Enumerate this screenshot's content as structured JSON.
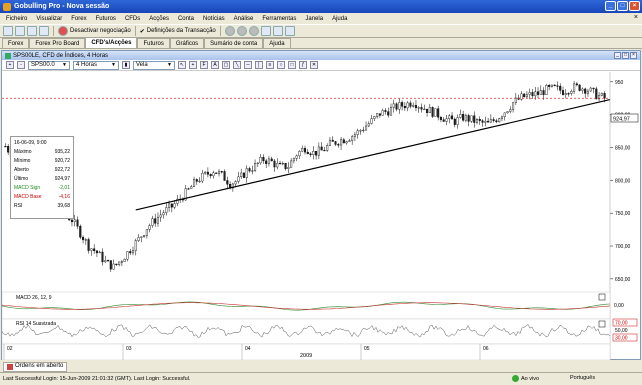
{
  "window": {
    "title": "Gobulling Pro - Nova sessão"
  },
  "menu": [
    "Ficheiro",
    "Visualizar",
    "Forex",
    "Futuros",
    "CFDs",
    "Acções",
    "Conta",
    "Notícias",
    "Análise",
    "Ferramentas",
    "Janela",
    "Ajuda"
  ],
  "toolbar": {
    "deactivate": "Desactivar negociação",
    "settings": "Definições da Transacção"
  },
  "tabs": [
    "Forex",
    "Forex Pro Board",
    "CFD's/Acções",
    "Futuros",
    "Gráficos",
    "Sumário de conta",
    "Ajuda"
  ],
  "active_tab": "CFD's/Acções",
  "chart_window": {
    "title": "SPS00LE, CFD de Índices, 4 Horas"
  },
  "chart_toolbar": {
    "symbol": "SPS00.0",
    "interval": "4 Horas",
    "type": "Vela"
  },
  "info": {
    "date": "16-06-09, 9:00",
    "rows": [
      {
        "label": "Máximo",
        "value": "935,22"
      },
      {
        "label": "Mínimo",
        "value": "920,72"
      },
      {
        "label": "Aberto",
        "value": "922,72"
      },
      {
        "label": "Último",
        "value": "924,97"
      },
      {
        "label": "MACD Sign",
        "value": "-2,01",
        "color": "green"
      },
      {
        "label": "MACD Base",
        "value": "-4,16",
        "color": "red"
      },
      {
        "label": "RSI",
        "value": "39,68"
      }
    ]
  },
  "chart_data": {
    "type": "candlestick",
    "price_axis": {
      "ticks": [
        950,
        900,
        850,
        800,
        750,
        700,
        650
      ],
      "tick_labels": [
        "950",
        "900,00",
        "850,00",
        "800,00",
        "750,00",
        "700,00",
        "650,00"
      ],
      "range": [
        630,
        965
      ]
    },
    "last_price": "924,97",
    "x_axis": {
      "ticks": [
        "02",
        "03",
        "04",
        "05",
        "06"
      ],
      "year_label": "2009"
    },
    "close_path": [
      [
        0,
        852
      ],
      [
        3,
        835
      ],
      [
        6,
        830
      ],
      [
        9,
        810
      ],
      [
        12,
        800
      ],
      [
        15,
        790
      ],
      [
        18,
        770
      ],
      [
        21,
        750
      ],
      [
        24,
        740
      ],
      [
        27,
        720
      ],
      [
        30,
        700
      ],
      [
        33,
        690
      ],
      [
        36,
        676
      ],
      [
        39,
        668
      ],
      [
        42,
        680
      ],
      [
        45,
        695
      ],
      [
        48,
        710
      ],
      [
        51,
        728
      ],
      [
        54,
        740
      ],
      [
        57,
        752
      ],
      [
        60,
        760
      ],
      [
        63,
        772
      ],
      [
        66,
        785
      ],
      [
        69,
        800
      ],
      [
        72,
        808
      ],
      [
        75,
        815
      ],
      [
        78,
        808
      ],
      [
        81,
        795
      ],
      [
        84,
        800
      ],
      [
        87,
        815
      ],
      [
        90,
        822
      ],
      [
        93,
        832
      ],
      [
        96,
        828
      ],
      [
        99,
        820
      ],
      [
        102,
        822
      ],
      [
        105,
        840
      ],
      [
        108,
        850
      ],
      [
        111,
        842
      ],
      [
        114,
        845
      ],
      [
        117,
        855
      ],
      [
        120,
        860
      ],
      [
        123,
        864
      ],
      [
        126,
        870
      ],
      [
        129,
        880
      ],
      [
        132,
        890
      ],
      [
        135,
        902
      ],
      [
        138,
        906
      ],
      [
        141,
        912
      ],
      [
        144,
        915
      ],
      [
        147,
        920
      ],
      [
        150,
        912
      ],
      [
        153,
        906
      ],
      [
        156,
        900
      ],
      [
        159,
        893
      ],
      [
        162,
        890
      ],
      [
        165,
        896
      ],
      [
        168,
        892
      ],
      [
        171,
        888
      ],
      [
        174,
        886
      ],
      [
        177,
        894
      ],
      [
        180,
        905
      ],
      [
        183,
        918
      ],
      [
        186,
        926
      ],
      [
        189,
        930
      ],
      [
        192,
        932
      ],
      [
        195,
        938
      ],
      [
        198,
        940
      ],
      [
        201,
        936
      ],
      [
        204,
        941
      ],
      [
        207,
        942
      ],
      [
        210,
        938
      ],
      [
        213,
        930
      ],
      [
        216,
        925
      ]
    ],
    "trendline": {
      "start": {
        "x": 0.22,
        "price": 755
      },
      "end": {
        "x": 1.0,
        "price": 923
      }
    },
    "resistance_level": 925,
    "indicators": [
      {
        "name": "MACD 26, 12, 9",
        "zero_label": "0,00"
      },
      {
        "name": "RSI 14 Suavizada",
        "levels": [
          "70,00",
          "50,00",
          "30,00"
        ]
      }
    ]
  },
  "order_tab": "Ordens em aberto",
  "status": {
    "last_login": "Last Successful Login: 15-Jun-2009 21:01:32 (GMT). Last Login: Successful.",
    "mode": "Ao vivo",
    "language": "Português"
  },
  "colors": {
    "bull": "#ffffff",
    "bear": "#222222",
    "trend": "#000000",
    "resistance": "#d03030",
    "macd_signal": "#2a8a2a",
    "macd_base": "#c83030"
  }
}
